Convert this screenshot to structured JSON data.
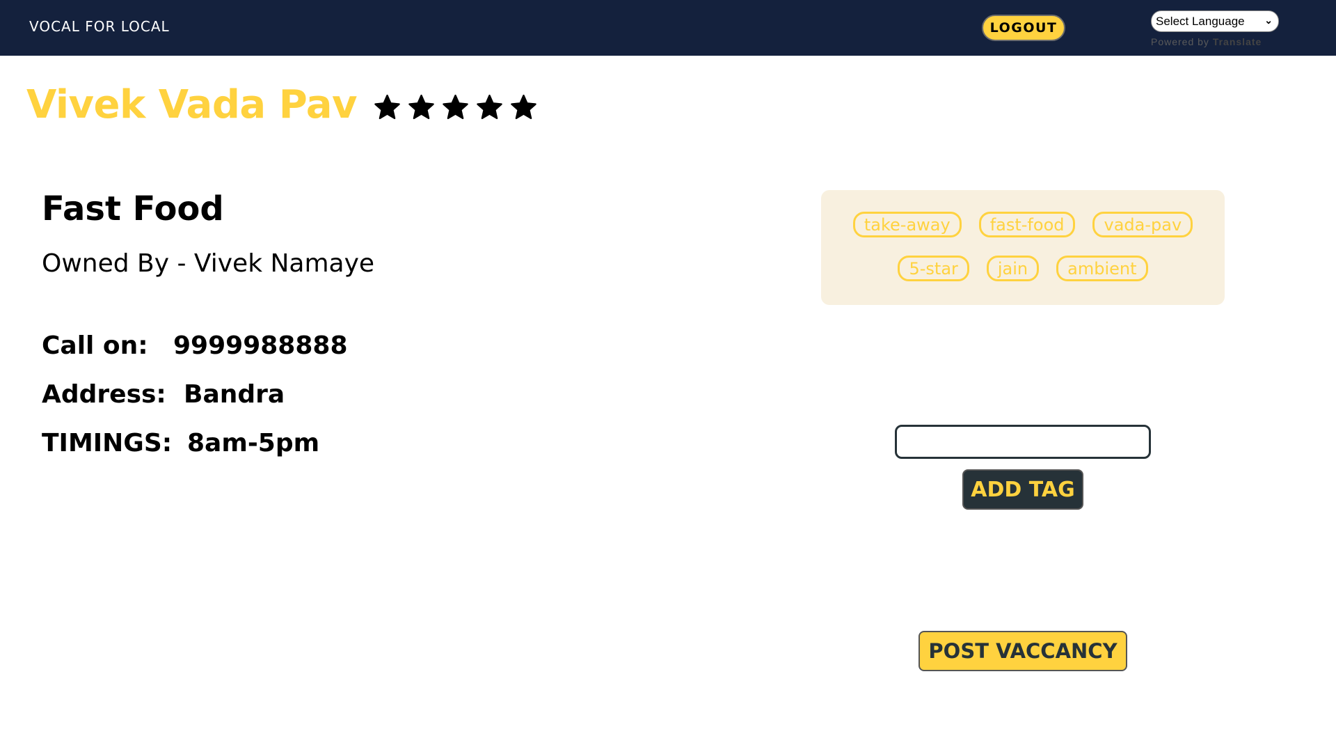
{
  "navbar": {
    "brand": "VOCAL FOR LOCAL",
    "logout_label": "LOGOUT",
    "language_select": {
      "selected": "Select Language",
      "icon": "chevron-down-icon"
    },
    "powered_by_prefix": "Powered by",
    "powered_by_brand": "Translate"
  },
  "shop": {
    "name": "Vivek Vada Pav",
    "rating": 5,
    "rating_max": 5,
    "star_icon": "star-icon",
    "category": "Fast Food",
    "owner_line": "Owned By - Vivek Namaye",
    "details": [
      {
        "label": "Call on:",
        "value": "9999988888"
      },
      {
        "label": "Address:",
        "value": "Bandra"
      },
      {
        "label": "TIMINGS:",
        "value": "8am-5pm"
      }
    ]
  },
  "tags": [
    "take-away",
    "fast-food",
    "vada-pav",
    "5-star",
    "jain",
    "ambient"
  ],
  "tag_form": {
    "input_value": "",
    "input_placeholder": "",
    "add_label": "ADD TAG"
  },
  "post_vacancy_label": "POST VACCANCY",
  "colors": {
    "navbar_bg": "#14213d",
    "accent_yellow": "#ffd23f",
    "dark_slate": "#263238",
    "tag_box_bg": "#f8f0df"
  }
}
